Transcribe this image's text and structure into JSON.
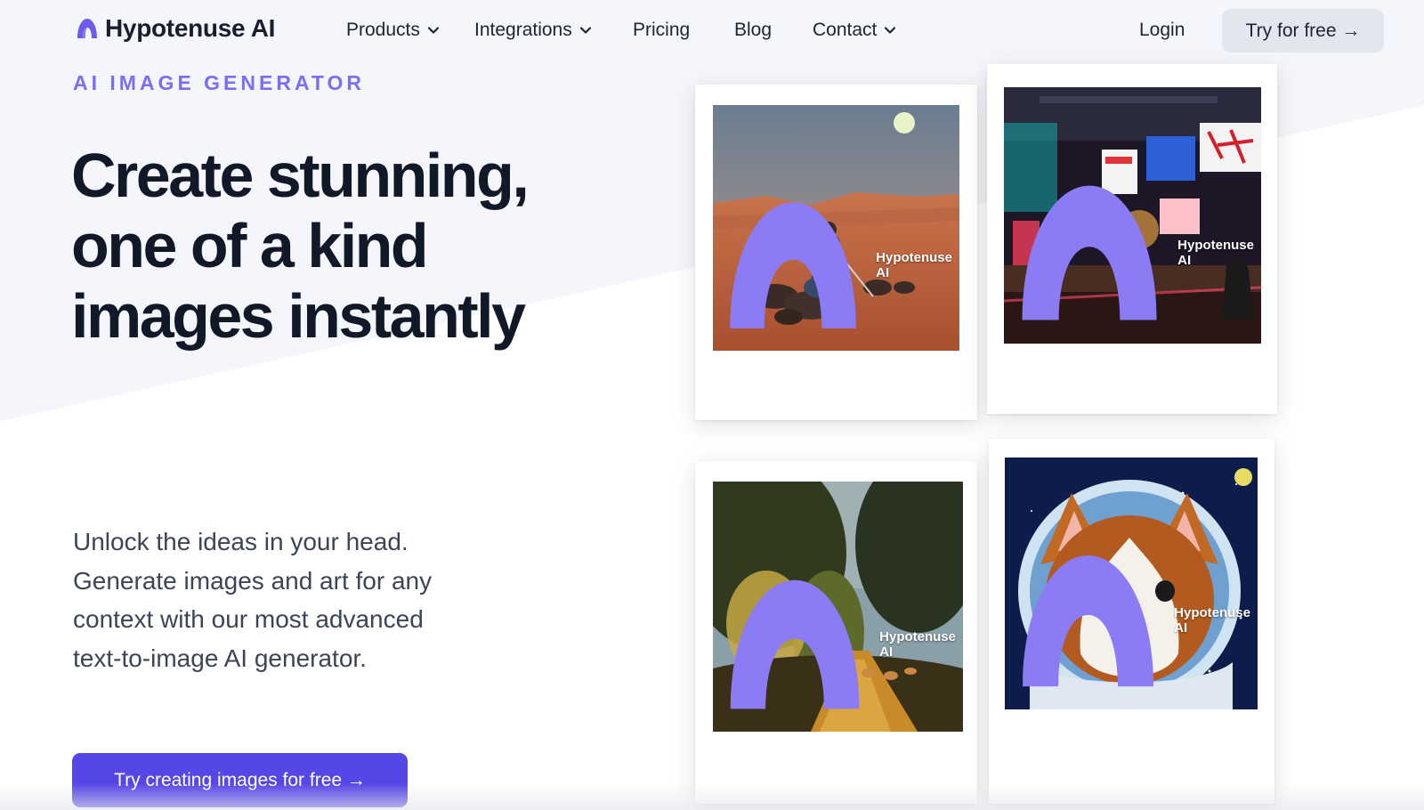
{
  "nav": {
    "logo_text": "Hypotenuse AI",
    "items": [
      {
        "label": "Products",
        "has_dropdown": true
      },
      {
        "label": "Integrations",
        "has_dropdown": true
      },
      {
        "label": "Pricing",
        "has_dropdown": false
      },
      {
        "label": "Blog",
        "has_dropdown": false
      },
      {
        "label": "Contact",
        "has_dropdown": true
      }
    ],
    "login_label": "Login",
    "try_label": "Try for free →"
  },
  "hero": {
    "eyebrow": "AI IMAGE GENERATOR",
    "headline": "Create stunning, one of a kind images instantly",
    "subtext": "Unlock the ideas in your head. Generate images and art for any context with our most advanced text-to-image AI generator.",
    "cta_label": "Try creating images for free →"
  },
  "gallery": {
    "watermark": "Hypotenuse AI",
    "images": [
      {
        "subject": "desert-figure"
      },
      {
        "subject": "neon-ramen-bar"
      },
      {
        "subject": "forest-deer"
      },
      {
        "subject": "corgi-astronaut"
      }
    ]
  },
  "colors": {
    "accent": "#7b6ef6",
    "cta_bg": "#5546e6",
    "headline": "#111827",
    "try_btn_bg": "#e3e6ee"
  }
}
